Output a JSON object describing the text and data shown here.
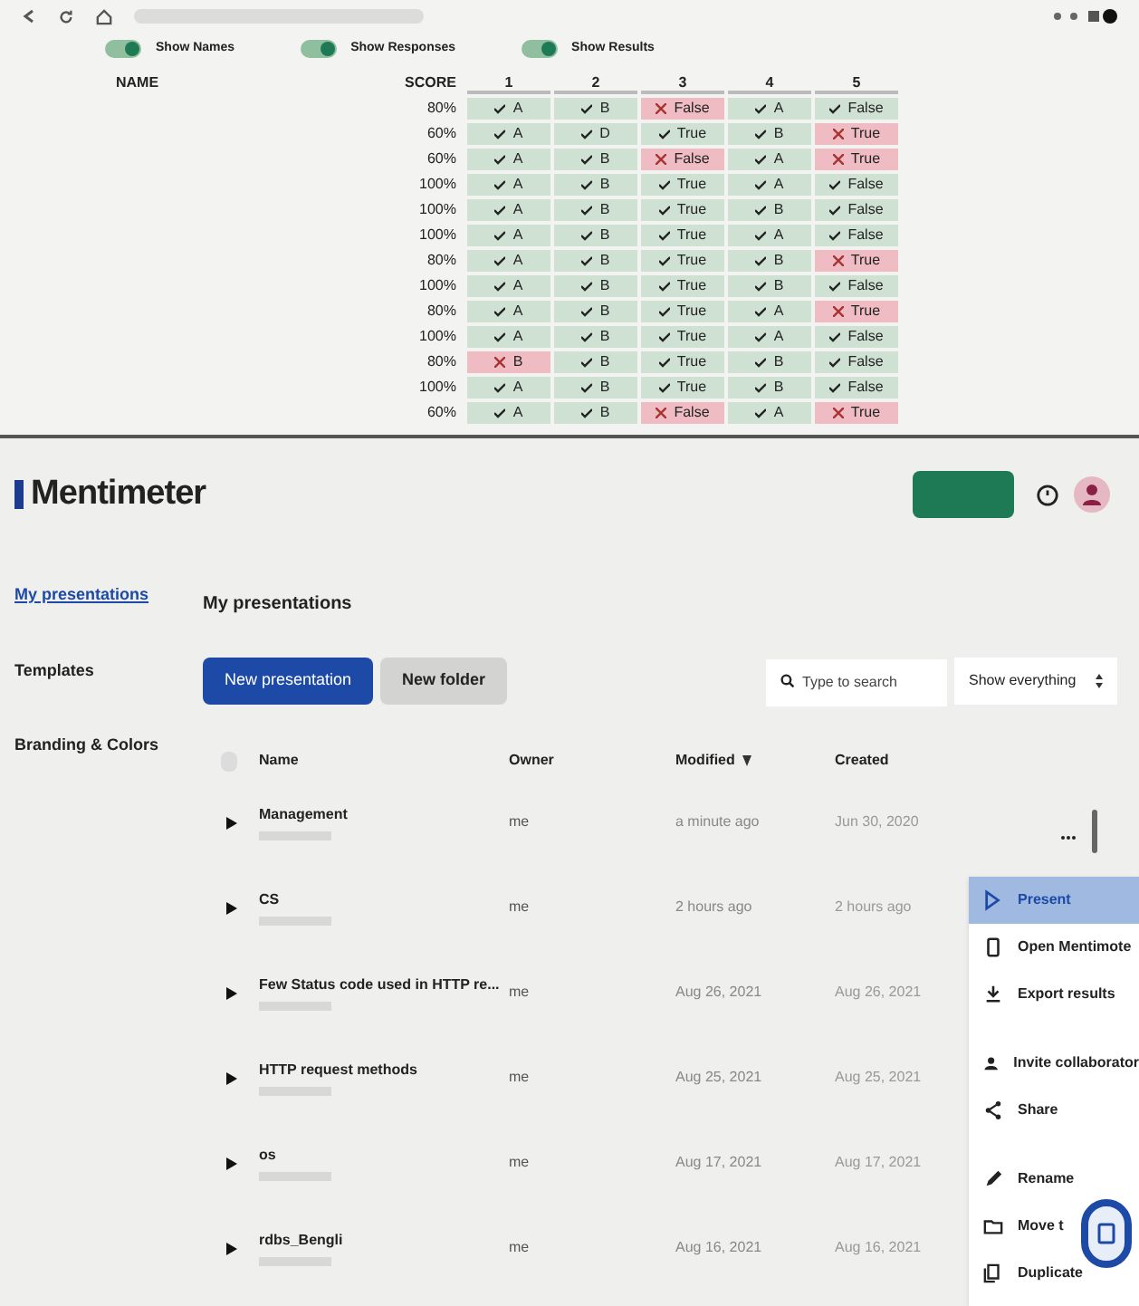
{
  "toggles": [
    {
      "label": "Show Names",
      "on": true
    },
    {
      "label": "Show Responses",
      "on": true
    },
    {
      "label": "Show Results",
      "on": true
    }
  ],
  "results": {
    "name_header": "NAME",
    "score_header": "SCORE",
    "question_headers": [
      "1",
      "2",
      "3",
      "4",
      "5"
    ],
    "rows": [
      {
        "score": "80%",
        "cells": [
          {
            "text": "A",
            "correct": true
          },
          {
            "text": "B",
            "correct": true
          },
          {
            "text": "False",
            "correct": false
          },
          {
            "text": "A",
            "correct": true
          },
          {
            "text": "False",
            "correct": true
          }
        ]
      },
      {
        "score": "60%",
        "cells": [
          {
            "text": "A",
            "correct": true
          },
          {
            "text": "D",
            "correct": true
          },
          {
            "text": "True",
            "correct": true
          },
          {
            "text": "B",
            "correct": true
          },
          {
            "text": "True",
            "correct": false
          }
        ]
      },
      {
        "score": "60%",
        "cells": [
          {
            "text": "A",
            "correct": true
          },
          {
            "text": "B",
            "correct": true
          },
          {
            "text": "False",
            "correct": false
          },
          {
            "text": "A",
            "correct": true
          },
          {
            "text": "True",
            "correct": false
          }
        ]
      },
      {
        "score": "100%",
        "cells": [
          {
            "text": "A",
            "correct": true
          },
          {
            "text": "B",
            "correct": true
          },
          {
            "text": "True",
            "correct": true
          },
          {
            "text": "A",
            "correct": true
          },
          {
            "text": "False",
            "correct": true
          }
        ]
      },
      {
        "score": "100%",
        "cells": [
          {
            "text": "A",
            "correct": true
          },
          {
            "text": "B",
            "correct": true
          },
          {
            "text": "True",
            "correct": true
          },
          {
            "text": "B",
            "correct": true
          },
          {
            "text": "False",
            "correct": true
          }
        ]
      },
      {
        "score": "100%",
        "cells": [
          {
            "text": "A",
            "correct": true
          },
          {
            "text": "B",
            "correct": true
          },
          {
            "text": "True",
            "correct": true
          },
          {
            "text": "A",
            "correct": true
          },
          {
            "text": "False",
            "correct": true
          }
        ]
      },
      {
        "score": "80%",
        "cells": [
          {
            "text": "A",
            "correct": true
          },
          {
            "text": "B",
            "correct": true
          },
          {
            "text": "True",
            "correct": true
          },
          {
            "text": "B",
            "correct": true
          },
          {
            "text": "True",
            "correct": false
          }
        ]
      },
      {
        "score": "100%",
        "cells": [
          {
            "text": "A",
            "correct": true
          },
          {
            "text": "B",
            "correct": true
          },
          {
            "text": "True",
            "correct": true
          },
          {
            "text": "B",
            "correct": true
          },
          {
            "text": "False",
            "correct": true
          }
        ]
      },
      {
        "score": "80%",
        "cells": [
          {
            "text": "A",
            "correct": true
          },
          {
            "text": "B",
            "correct": true
          },
          {
            "text": "True",
            "correct": true
          },
          {
            "text": "A",
            "correct": true
          },
          {
            "text": "True",
            "correct": false
          }
        ]
      },
      {
        "score": "100%",
        "cells": [
          {
            "text": "A",
            "correct": true
          },
          {
            "text": "B",
            "correct": true
          },
          {
            "text": "True",
            "correct": true
          },
          {
            "text": "A",
            "correct": true
          },
          {
            "text": "False",
            "correct": true
          }
        ]
      },
      {
        "score": "80%",
        "cells": [
          {
            "text": "B",
            "correct": false
          },
          {
            "text": "B",
            "correct": true
          },
          {
            "text": "True",
            "correct": true
          },
          {
            "text": "B",
            "correct": true
          },
          {
            "text": "False",
            "correct": true
          }
        ]
      },
      {
        "score": "100%",
        "cells": [
          {
            "text": "A",
            "correct": true
          },
          {
            "text": "B",
            "correct": true
          },
          {
            "text": "True",
            "correct": true
          },
          {
            "text": "B",
            "correct": true
          },
          {
            "text": "False",
            "correct": true
          }
        ]
      },
      {
        "score": "60%",
        "cells": [
          {
            "text": "A",
            "correct": true
          },
          {
            "text": "B",
            "correct": true
          },
          {
            "text": "False",
            "correct": false
          },
          {
            "text": "A",
            "correct": true
          },
          {
            "text": "True",
            "correct": false
          }
        ]
      }
    ]
  },
  "app": {
    "logo": "Mentimeter",
    "sidebar": [
      {
        "label": "My presentations",
        "selected": true
      },
      {
        "label": "Templates",
        "selected": false
      },
      {
        "label": "Branding & Colors",
        "selected": false
      }
    ],
    "heading": "My presentations",
    "new_presentation": "New presentation",
    "new_folder": "New folder",
    "search": {
      "placeholder": "Type to search"
    },
    "filter": "Show everything",
    "select_all_checked": false,
    "columns": [
      "Name",
      "Owner",
      "Modified",
      "Created"
    ],
    "presentations": [
      {
        "name": "Management",
        "owner": "me",
        "modified": "a minute ago",
        "created": "Jun 30, 2020"
      },
      {
        "name": "CS",
        "owner": "me",
        "modified": "2 hours ago",
        "created": "2 hours ago"
      },
      {
        "name": "Few Status code used in HTTP re...",
        "owner": "me",
        "modified": "Aug 26, 2021",
        "created": "Aug 26, 2021"
      },
      {
        "name": "HTTP request methods",
        "owner": "me",
        "modified": "Aug 25, 2021",
        "created": "Aug 25, 2021"
      },
      {
        "name": "os",
        "owner": "me",
        "modified": "Aug 17, 2021",
        "created": "Aug 17, 2021"
      },
      {
        "name": "rdbs_Bengli",
        "owner": "me",
        "modified": "Aug 16, 2021",
        "created": "Aug 16, 2021"
      }
    ],
    "menu": [
      {
        "kind": "present",
        "label": "Present",
        "selected": true
      },
      {
        "kind": "phone",
        "label": "Open Mentimote",
        "selected": false
      },
      {
        "kind": "export",
        "label": "Export results",
        "selected": false
      },
      {
        "kind": "invite",
        "label": "Invite collaborator",
        "selected": false
      },
      {
        "kind": "share",
        "label": "Share",
        "selected": false
      },
      {
        "kind": "rename",
        "label": "Rename",
        "selected": false
      },
      {
        "kind": "move",
        "label": "Move t",
        "selected": false
      },
      {
        "kind": "duplicate",
        "label": "Duplicate",
        "selected": false
      }
    ]
  }
}
